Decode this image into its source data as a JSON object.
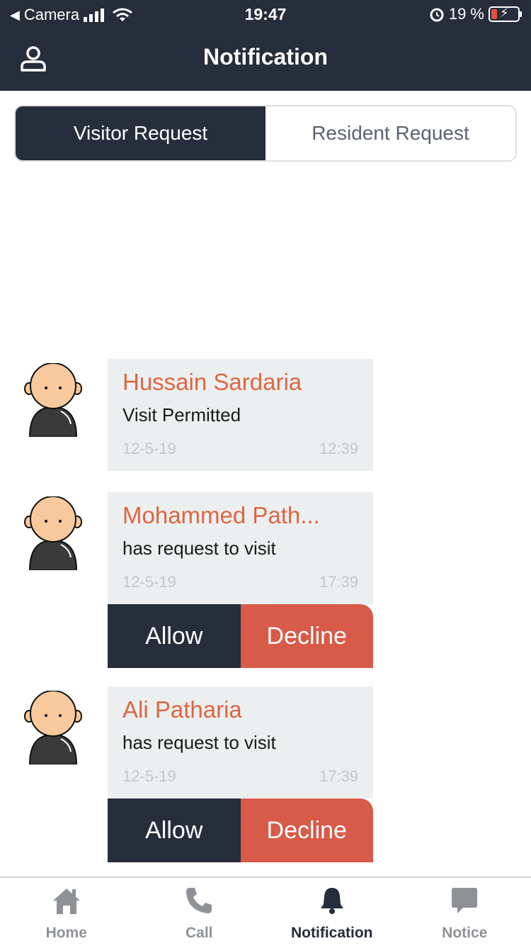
{
  "status_bar": {
    "back_app": "Camera",
    "time": "19:47",
    "battery": "19 %"
  },
  "header": {
    "title": "Notification",
    "profile_icon": "user-icon"
  },
  "segment": {
    "tabs": [
      "Visitor Request",
      "Resident Request"
    ],
    "active": "Visitor Request"
  },
  "notifications": [
    {
      "name": "Hussain Sardaria",
      "message": "Visit Permitted",
      "date": "12-5-19",
      "time": "12:39"
    },
    {
      "name": "Mohammed Path...",
      "message": "has request to visit",
      "date": "12-5-19",
      "time": "17:39",
      "actions": {
        "allow": "Allow",
        "decline": "Decline"
      }
    },
    {
      "name": "Ali Patharia",
      "message": "has request to visit",
      "date": "12-5-19",
      "time": "17:39",
      "actions": {
        "allow": "Allow",
        "decline": "Decline"
      }
    }
  ],
  "tabbar": {
    "items": [
      {
        "label": "Home",
        "icon": "home-icon"
      },
      {
        "label": "Call",
        "icon": "phone-icon"
      },
      {
        "label": "Notification",
        "icon": "bell-icon"
      },
      {
        "label": "Notice",
        "icon": "chat-icon"
      }
    ],
    "active": "Notification"
  },
  "colors": {
    "primary_dark": "#262d3b",
    "accent_orange": "#dd6641",
    "decline_red": "#d85a48",
    "card_bg": "#eceff0"
  }
}
